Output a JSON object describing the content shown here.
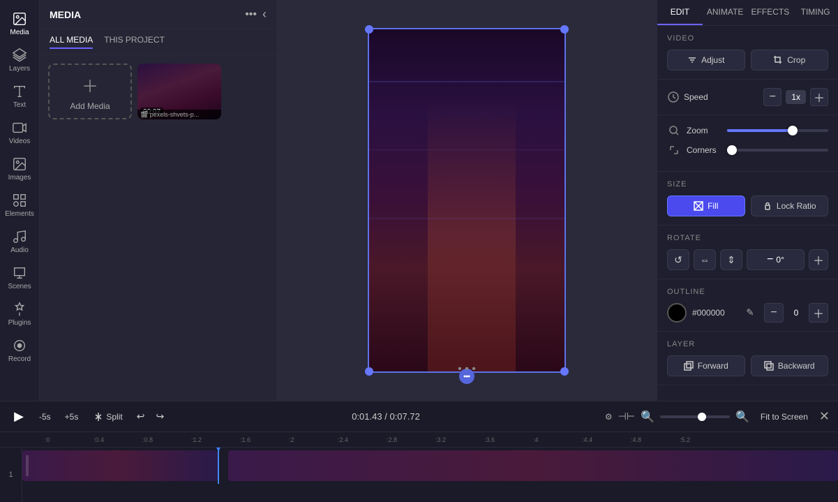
{
  "sidebar": {
    "items": [
      {
        "id": "media",
        "label": "Media",
        "active": true
      },
      {
        "id": "layers",
        "label": "Layers",
        "active": false
      },
      {
        "id": "text",
        "label": "Text",
        "active": false
      },
      {
        "id": "videos",
        "label": "Videos",
        "active": false
      },
      {
        "id": "images",
        "label": "Images",
        "active": false
      },
      {
        "id": "elements",
        "label": "Elements",
        "active": false
      },
      {
        "id": "audio",
        "label": "Audio",
        "active": false
      },
      {
        "id": "scenes",
        "label": "Scenes",
        "active": false
      },
      {
        "id": "plugins",
        "label": "Plugins",
        "active": false
      },
      {
        "id": "record",
        "label": "Record",
        "active": false
      }
    ]
  },
  "media_panel": {
    "title": "MEDIA",
    "tabs": [
      "ALL MEDIA",
      "THIS PROJECT"
    ],
    "active_tab": "ALL MEDIA",
    "add_label": "Add Media",
    "thumb_duration": "00:07",
    "thumb_name": "pexels-shvets-p..."
  },
  "right_panel": {
    "tabs": [
      "EDIT",
      "ANIMATE",
      "EFFECTS",
      "TIMING"
    ],
    "active_tab": "EDIT",
    "video_section": "VIDEO",
    "adjust_label": "Adjust",
    "crop_label": "Crop",
    "speed_label": "Speed",
    "speed_value": "1x",
    "zoom_label": "Zoom",
    "corners_label": "Corners",
    "size_section": "SIZE",
    "fill_label": "Fill",
    "lock_ratio_label": "Lock Ratio",
    "rotate_section": "ROTATE",
    "rotate_value": "0°",
    "outline_section": "OUTLINE",
    "outline_color": "#000000",
    "outline_hex": "#000000",
    "outline_value": "0",
    "layer_section": "LAYER",
    "forward_label": "Forward",
    "backward_label": "Backward"
  },
  "timeline": {
    "play_label": "▶",
    "skip_back": "-5s",
    "skip_forward": "+5s",
    "split_label": "Split",
    "time_current": "0:01.43",
    "time_total": "0:07.72",
    "fit_screen_label": "Fit to Screen",
    "ruler_marks": [
      ":0",
      ":0.4",
      ":0.8",
      ":1.2",
      ":1.6",
      ":2",
      ":2.4",
      ":2.8",
      ":3.2",
      ":3.6",
      ":4",
      ":4.4",
      ":4.8",
      ":5.2"
    ],
    "track_number": "1"
  }
}
